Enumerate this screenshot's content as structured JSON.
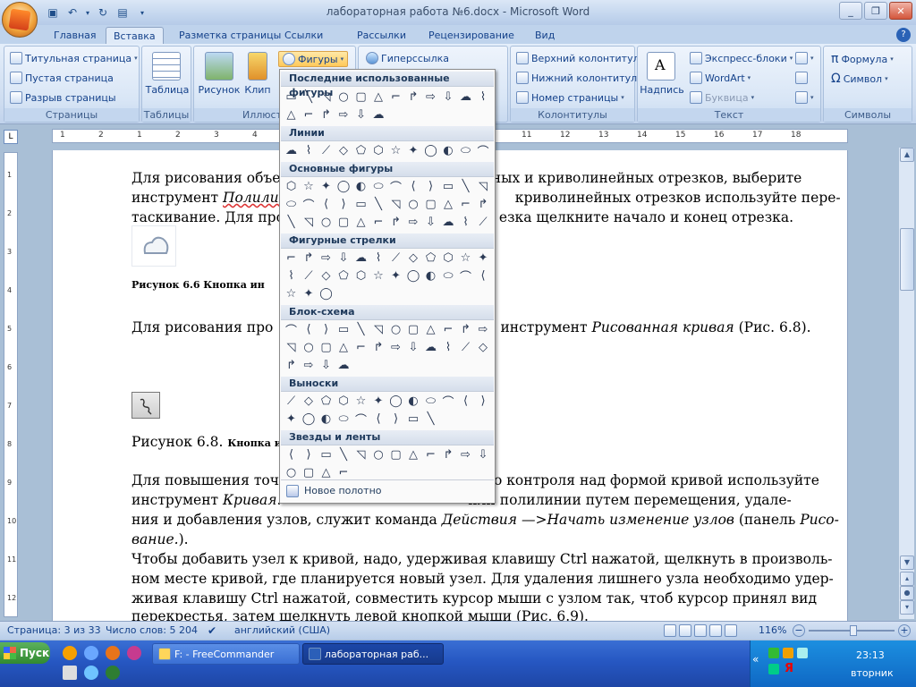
{
  "window": {
    "title": "лабораторная работа №6.docx - Microsoft Word"
  },
  "tabs": [
    "Главная",
    "Вставка",
    "Разметка страницы",
    "Ссылки",
    "Рассылки",
    "Рецензирование",
    "Вид"
  ],
  "active_tab": "Вставка",
  "ribbon": {
    "pages": {
      "items": [
        "Титульная страница",
        "Пустая страница",
        "Разрыв страницы"
      ],
      "label": "Страницы"
    },
    "tables": {
      "button": "Таблица",
      "label": "Таблицы"
    },
    "illustrations": {
      "picture": "Рисунок",
      "clip": "Клип",
      "shapes": "Фигуры",
      "label": "Иллюст"
    },
    "links": {
      "hyperlink": "Гиперссылка"
    },
    "headers": {
      "items": [
        "Верхний колонтитул",
        "Нижний колонтитул",
        "Номер страницы"
      ],
      "label": "Колонтитулы"
    },
    "text": {
      "textbox": "Надпись",
      "items": [
        "Экспресс-блоки",
        "WordArt",
        "Буквица"
      ],
      "label": "Текст"
    },
    "symbols": {
      "items": [
        "Формула",
        "Символ"
      ],
      "label": "Символы"
    }
  },
  "shapes_menu": {
    "sections": [
      "Последние использованные фигуры",
      "Линии",
      "Основные фигуры",
      "Фигурные стрелки",
      "Блок-схема",
      "Выноски",
      "Звезды и ленты"
    ],
    "new_canvas": "Новое полотно"
  },
  "document": {
    "p1": [
      "Для рисования объе",
      "йных и криволинейных отрезков, выберите",
      "инструмент ",
      "Полилин",
      "криволинейных отрезков используйте пере-",
      "таскивание. Для про",
      "езка щелкните начало и конец отрезка."
    ],
    "fig66": "Рисунок 6.6 Кнопка ин",
    "p2a": "Для рисования про",
    "p2b": "е инструмент ",
    "p2c": "Рисованная кривая",
    "p2d": "  (Рис. 6.8).",
    "fig68a": "Рисунок 6.8. ",
    "fig68b": "Кнопка и",
    "p3": [
      "Для повышения точ",
      "о контроля над формой кривой используйте",
      "инструмент ",
      "Кривая",
      ". ",
      "или полилинии путем перемещения, удале-",
      "ния и добавления узлов, служит команда ",
      "Действия —>Начать изменение узлов",
      " (панель ",
      "Рисо-",
      "вание.",
      ")."
    ],
    "p4": [
      "Чтобы добавить узел к кривой, надо, удерживая клавишу Ctrl  нажатой, щелкнуть в произволь-",
      "ном месте кривой, где планируется новый узел. Для удаления лишнего узла необходимо удер-",
      "живая клавишу Ctrl  нажатой, совместить курсор мыши с узлом так, чтоб курсор принял вид",
      "перекрестья, затем щелкнуть левой кнопкой мыши (Рис. 6.9)."
    ]
  },
  "ruler_numbers": [
    "1",
    "2",
    "1",
    "2",
    "3",
    "4",
    "5",
    "6",
    "7",
    "8",
    "9",
    "10",
    "11",
    "12",
    "13",
    "14",
    "15",
    "16",
    "17",
    "18"
  ],
  "vruler_numbers": [
    "1",
    "2",
    "3",
    "4",
    "5",
    "6",
    "7",
    "8",
    "9",
    "10",
    "11",
    "12"
  ],
  "status": {
    "page": "Страница: 3 из 33",
    "words": "Число слов: 5 204",
    "language": "английский (США)",
    "zoom": "116%"
  },
  "taskbar": {
    "start": "Пуск",
    "tasks": [
      "F: - FreeCommander",
      "лабораторная раб..."
    ],
    "lang": "EN",
    "time": "23:13",
    "day": "вторник"
  }
}
